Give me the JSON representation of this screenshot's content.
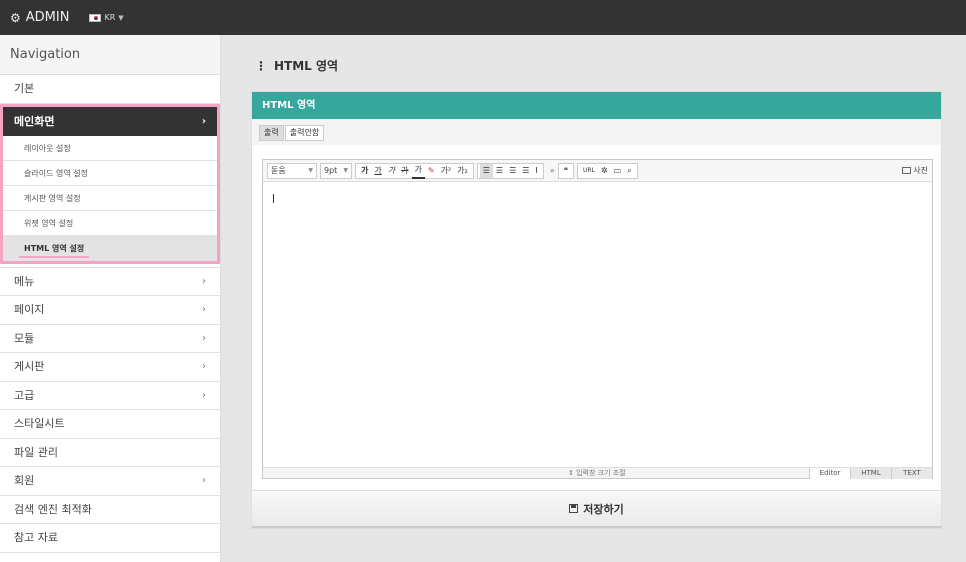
{
  "topbar": {
    "brand": "ADMIN",
    "lang": "KR"
  },
  "nav": {
    "heading": "Navigation",
    "top_item": "기본",
    "active_item": "메인화면",
    "sub_items": [
      "레이아웃 설정",
      "슬라이드 영역 설정",
      "게시판 영역 설정",
      "위젯 영역 설정",
      "HTML 영역 설정"
    ],
    "items": [
      "메뉴",
      "페이지",
      "모듈",
      "게시판",
      "고급",
      "스타일시트",
      "파일 관리",
      "회원",
      "검색 엔진 최적화",
      "참고 자료"
    ]
  },
  "page": {
    "title": "HTML 영역"
  },
  "panel": {
    "header": "HTML 영역",
    "tabs": [
      "출력",
      "출력안함"
    ],
    "save_label": "저장하기"
  },
  "editor": {
    "font_select": "돋움",
    "size_select": "9pt",
    "photo_label": "사진",
    "resize_label": "⇕ 입력창 크기 조절",
    "modes": [
      "Editor",
      "HTML",
      "TEXT"
    ]
  },
  "colors": {
    "accent": "#36a79d",
    "topbar": "#333333",
    "highlight": "#f3a4c4"
  }
}
